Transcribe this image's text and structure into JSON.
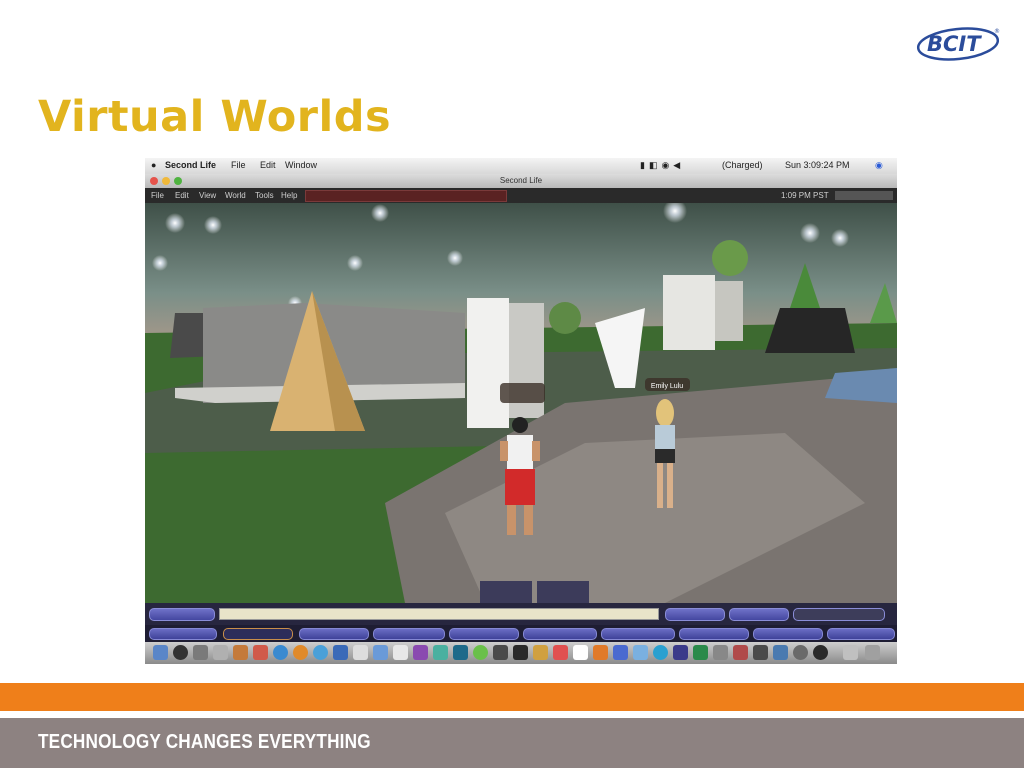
{
  "slide": {
    "title": "Virtual Worlds",
    "tagline": "TECHNOLOGY CHANGES EVERYTHING",
    "logo_text": "BCIT",
    "colors": {
      "title": "#e2b41e",
      "orange_band": "#ef7f1a",
      "footer": "#8d8281",
      "logo": "#2b4c9b"
    }
  },
  "screenshot": {
    "mac_menubar": {
      "app": "Second Life",
      "items": [
        "File",
        "Edit",
        "Window"
      ],
      "battery": "(Charged)",
      "clock": "Sun 3:09:24 PM"
    },
    "window_title": "Second Life",
    "sl_menu": {
      "items": [
        "File",
        "Edit",
        "View",
        "World",
        "Tools",
        "Help"
      ],
      "time": "1:09 PM PST"
    },
    "nametags": [
      "",
      "Emily Lulu"
    ]
  }
}
